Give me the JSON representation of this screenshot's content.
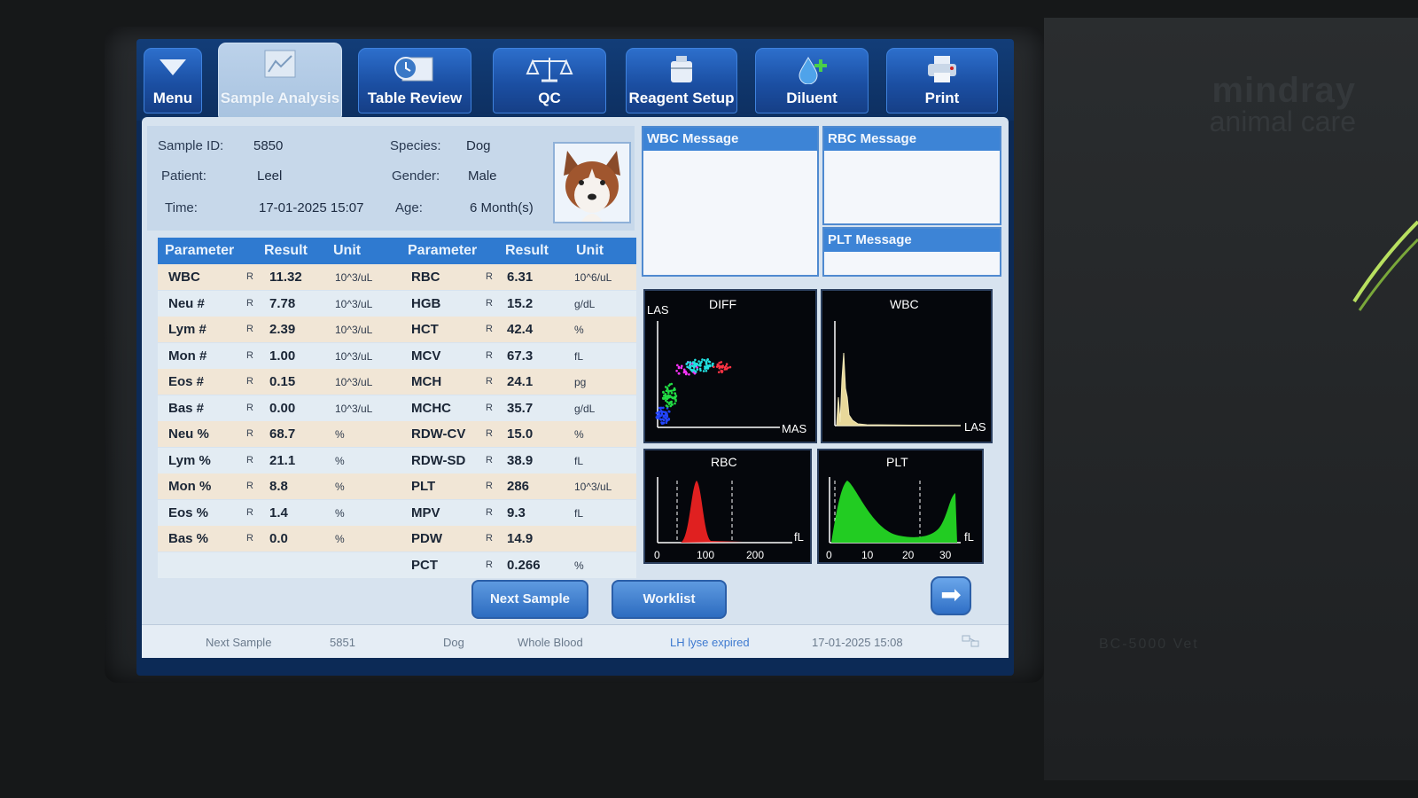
{
  "brand": {
    "name": "mindray",
    "sub": "animal care",
    "model": "BC-5000 Vet"
  },
  "toolbar": {
    "menu": "Menu",
    "sample_analysis": "Sample Analysis",
    "table_review": "Table Review",
    "qc": "QC",
    "reagent_setup": "Reagent Setup",
    "diluent": "Diluent",
    "print": "Print"
  },
  "patient": {
    "sample_id_label": "Sample ID:",
    "sample_id": "5850",
    "patient_label": "Patient:",
    "patient": "Leel",
    "time_label": "Time:",
    "time": "17-01-2025 15:07",
    "species_label": "Species:",
    "species": "Dog",
    "gender_label": "Gender:",
    "gender": "Male",
    "age_label": "Age:",
    "age": "6 Month(s)"
  },
  "table": {
    "headers": [
      "Parameter",
      "Result",
      "Unit",
      "Parameter",
      "Result",
      "Unit"
    ],
    "rows": [
      {
        "p1": "WBC",
        "f1": "R",
        "r1": "11.32",
        "u1": "10^3/uL",
        "p2": "RBC",
        "f2": "R",
        "r2": "6.31",
        "u2": "10^6/uL"
      },
      {
        "p1": "Neu #",
        "f1": "R",
        "r1": "7.78",
        "u1": "10^3/uL",
        "p2": "HGB",
        "f2": "R",
        "r2": "15.2",
        "u2": "g/dL"
      },
      {
        "p1": "Lym #",
        "f1": "R",
        "r1": "2.39",
        "u1": "10^3/uL",
        "p2": "HCT",
        "f2": "R",
        "r2": "42.4",
        "u2": "%"
      },
      {
        "p1": "Mon #",
        "f1": "R",
        "r1": "1.00",
        "u1": "10^3/uL",
        "p2": "MCV",
        "f2": "R",
        "r2": "67.3",
        "u2": "fL"
      },
      {
        "p1": "Eos #",
        "f1": "R",
        "r1": "0.15",
        "u1": "10^3/uL",
        "p2": "MCH",
        "f2": "R",
        "r2": "24.1",
        "u2": "pg"
      },
      {
        "p1": "Bas #",
        "f1": "R",
        "r1": "0.00",
        "u1": "10^3/uL",
        "p2": "MCHC",
        "f2": "R",
        "r2": "35.7",
        "u2": "g/dL"
      },
      {
        "p1": "Neu %",
        "f1": "R",
        "r1": "68.7",
        "u1": "%",
        "p2": "RDW-CV",
        "f2": "R",
        "r2": "15.0",
        "u2": "%"
      },
      {
        "p1": "Lym %",
        "f1": "R",
        "r1": "21.1",
        "u1": "%",
        "p2": "RDW-SD",
        "f2": "R",
        "r2": "38.9",
        "u2": "fL"
      },
      {
        "p1": "Mon %",
        "f1": "R",
        "r1": "8.8",
        "u1": "%",
        "p2": "PLT",
        "f2": "R",
        "r2": "286",
        "u2": "10^3/uL"
      },
      {
        "p1": "Eos %",
        "f1": "R",
        "r1": "1.4",
        "u1": "%",
        "p2": "MPV",
        "f2": "R",
        "r2": "9.3",
        "u2": "fL"
      },
      {
        "p1": "Bas %",
        "f1": "R",
        "r1": "0.0",
        "u1": "%",
        "p2": "PDW",
        "f2": "R",
        "r2": "14.9",
        "u2": ""
      },
      {
        "p1": "",
        "f1": "",
        "r1": "",
        "u1": "",
        "p2": "PCT",
        "f2": "R",
        "r2": "0.266",
        "u2": "%"
      }
    ]
  },
  "messages": {
    "wbc": "WBC Message",
    "rbc": "RBC Message",
    "plt": "PLT Message"
  },
  "graphs": {
    "diff": {
      "title": "DIFF",
      "y_label": "LAS",
      "x_label": "MAS"
    },
    "wbc": {
      "title": "WBC",
      "x_label": "LAS"
    },
    "rbc": {
      "title": "RBC",
      "unit": "fL",
      "ticks": [
        "0",
        "100",
        "200"
      ]
    },
    "plt": {
      "title": "PLT",
      "unit": "fL",
      "ticks": [
        "0",
        "10",
        "20",
        "30"
      ]
    }
  },
  "buttons": {
    "next_sample": "Next Sample",
    "worklist": "Worklist",
    "next_arrow": "➡"
  },
  "status": {
    "next_sample_label": "Next Sample",
    "next_sample_id": "5851",
    "species": "Dog",
    "mode": "Whole Blood",
    "warning": "LH lyse expired",
    "datetime": "17-01-2025 15:08"
  },
  "colors": {
    "toolbar_bg": "#0d2f60",
    "button_blue": "#2d6fcc",
    "header_blue": "#2f7ad0",
    "rbc_curve": "#e02020",
    "plt_curve": "#22cc22",
    "wbc_curve": "#e8d89a"
  }
}
